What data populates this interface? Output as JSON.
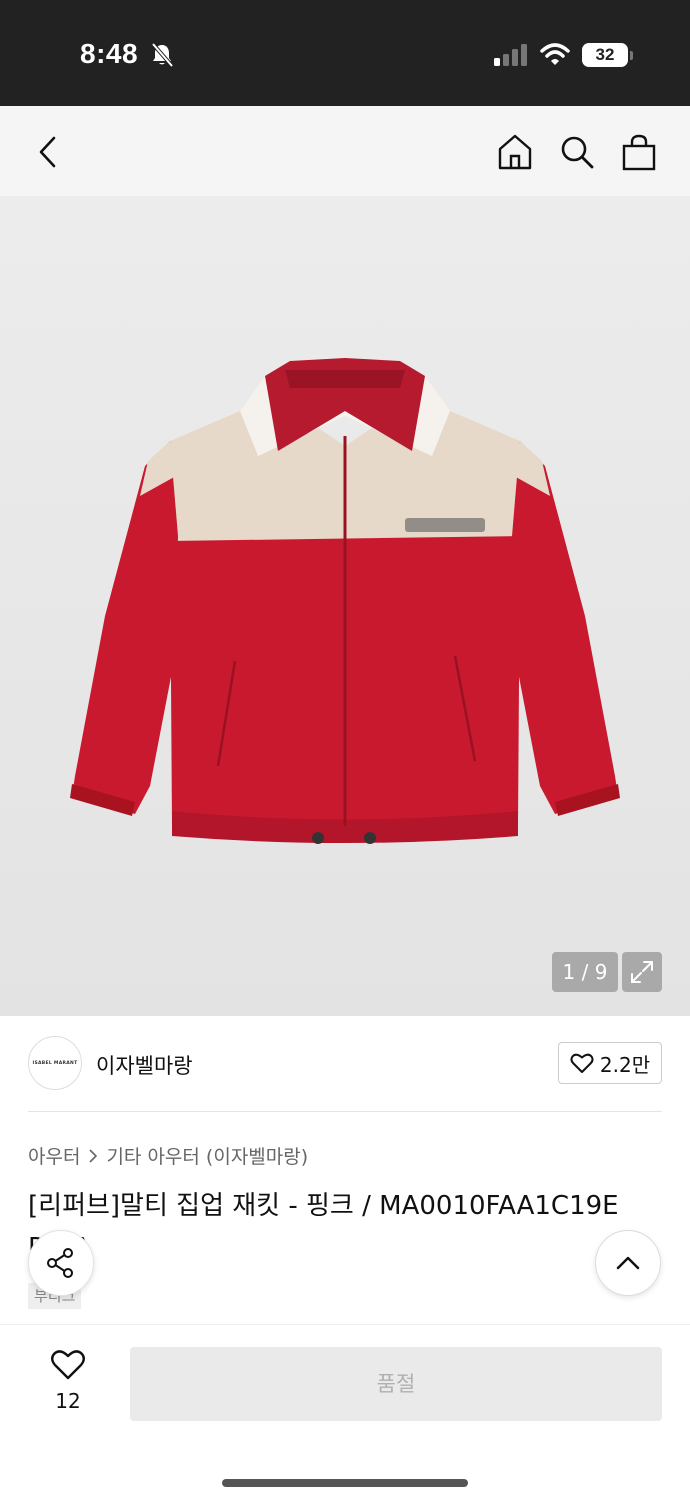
{
  "status_bar": {
    "time": "8:48",
    "battery": "32"
  },
  "product": {
    "image_counter": "1 / 9",
    "brand_logo_text": "ISABEL MARANT",
    "brand_name": "이자벨마랑",
    "likes": "2.2만",
    "breadcrumb": [
      "아우터",
      "기타 아우터 (이자벨마랑)"
    ],
    "title": "[리퍼브]말티 집업 재킷 - 핑크 / MA0010FAA1C19E PKFA",
    "tag": "부티크"
  },
  "bottom_bar": {
    "wish_count": "12",
    "soldout_label": "품절"
  },
  "colors": {
    "jacket_red": "#c8192f",
    "jacket_beige": "#e6d9c9",
    "status_bar_bg": "#222222"
  }
}
